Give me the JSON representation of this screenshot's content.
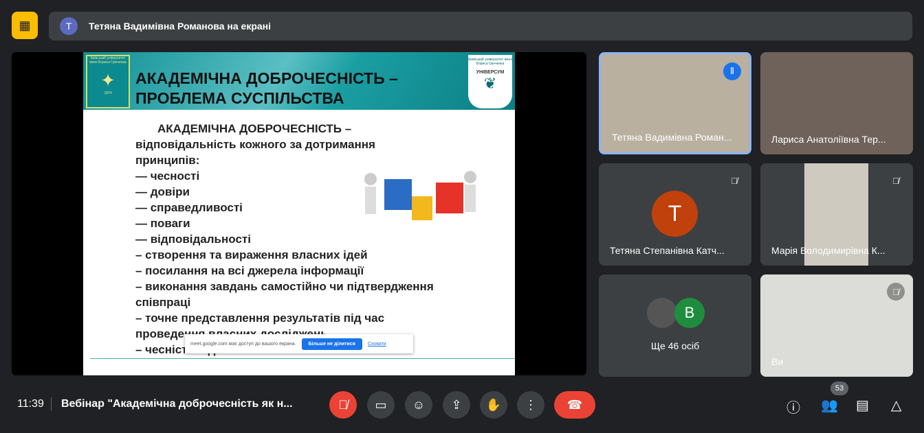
{
  "banner": {
    "avatar": "T",
    "text": "Тетяна Вадимівна Романова на екрані"
  },
  "slide": {
    "title_line1": "АКАДЕМІЧНА ДОБРОЧЕСНІСТЬ –",
    "title_line2": "ПРОБЛЕМА СУСПІЛЬСТВА",
    "logo_left_text": "Київський університет імені Бориса Грінченка",
    "logo_left_year": "1874",
    "logo_right_text": "Київський університет імені Бориса Грінченка",
    "logo_right_name": "УНІВЕРСУМ",
    "lines": [
      "АКАДЕМІЧНА ДОБРОЧЕСНІСТЬ –",
      "відповідальність кожного за дотримання",
      "принципів:",
      "— чесності",
      "— довіри",
      "— справедливості",
      "— поваги",
      "— відповідальності",
      "– створення та вираження власних ідей",
      "– посилання на всі джерела інформації",
      "– виконання завдань самостійно чи підтвердження",
      "співпраці",
      "– точне представлення результатів під час",
      "проведення власних досліджень",
      "– чесність під час екзаменів"
    ]
  },
  "share_bar": {
    "text": "meet.google.com має доступ до вашого екрана.",
    "stop_label": "Більше не ділитися",
    "hide_label": "Сховати"
  },
  "participants": [
    {
      "name": "Тетяна Вадимівна Роман...",
      "speaking": true
    },
    {
      "name": "Лариса Анатоліївна Тер..."
    },
    {
      "name": "Тетяна Степанівна Катч...",
      "avatar": "T",
      "avatar_color": "#c1410c"
    },
    {
      "name": "Марія Володимирівна К..."
    },
    {
      "name": "Ще 46 осіб",
      "avatar": "B",
      "avatar_color": "#1e8e3e"
    },
    {
      "name": "Ви"
    }
  ],
  "bottom": {
    "time": "11:39",
    "meeting_title": "Вебінар \"Академічна доброчесність як н...",
    "participant_count": "53"
  },
  "colors": {
    "accent_red": "#ea4335",
    "speaking_blue": "#1a73e8",
    "bg": "#202124"
  }
}
